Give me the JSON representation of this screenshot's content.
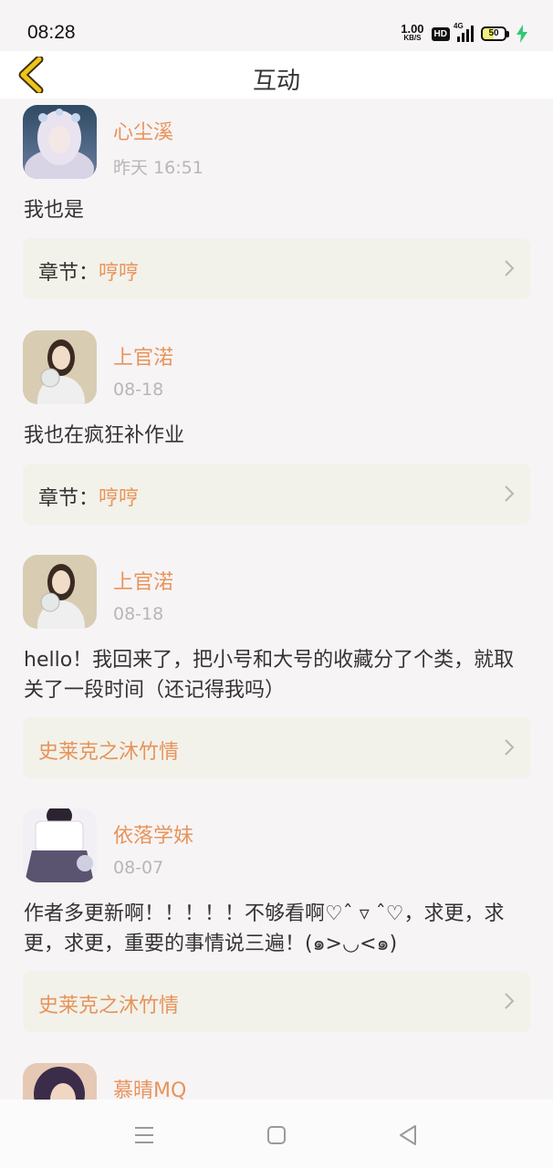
{
  "status_bar": {
    "time": "08:28",
    "net_speed_value": "1.00",
    "net_speed_unit": "KB/S",
    "hd_label": "HD",
    "network_label": "4G",
    "battery_level": "50",
    "icons": [
      "hd-icon",
      "signal-icon",
      "battery-icon",
      "charging-icon"
    ]
  },
  "nav": {
    "title": "互动",
    "back_icon": "chevron-left-icon",
    "accent_color": "#f0c419"
  },
  "posts": [
    {
      "username": "心尘溪",
      "date": "昨天 16:51",
      "text": "我也是",
      "card": {
        "label": "章节：",
        "value": "哼哼"
      }
    },
    {
      "username": "上官渃",
      "date": "08-18",
      "text": "我也在疯狂补作业",
      "card": {
        "label": "章节：",
        "value": "哼哼"
      }
    },
    {
      "username": "上官渃",
      "date": "08-18",
      "text": "hello！我回来了，把小号和大号的收藏分了个类，就取关了一段时间（还记得我吗）",
      "card": {
        "label": "",
        "value": "史莱克之沐竹情"
      }
    },
    {
      "username": "依落学妹",
      "date": "08-07",
      "text": "作者多更新啊！！！！！不够看啊♡ˆ ▿ ˆ♡，求更，求更，求更，重要的事情说三遍！(๑>◡<๑)",
      "card": {
        "label": "",
        "value": "史莱克之沐竹情"
      }
    },
    {
      "username": "慕晴MQ",
      "date": "",
      "text": ""
    }
  ],
  "colors": {
    "username": "#e8935a",
    "date": "#b9b6b8",
    "card_bg": "#f2f2ea",
    "page_bg": "#f7f4f6"
  },
  "bottom_nav": {
    "icons": [
      "menu-icon",
      "home-square-icon",
      "back-triangle-icon"
    ]
  }
}
